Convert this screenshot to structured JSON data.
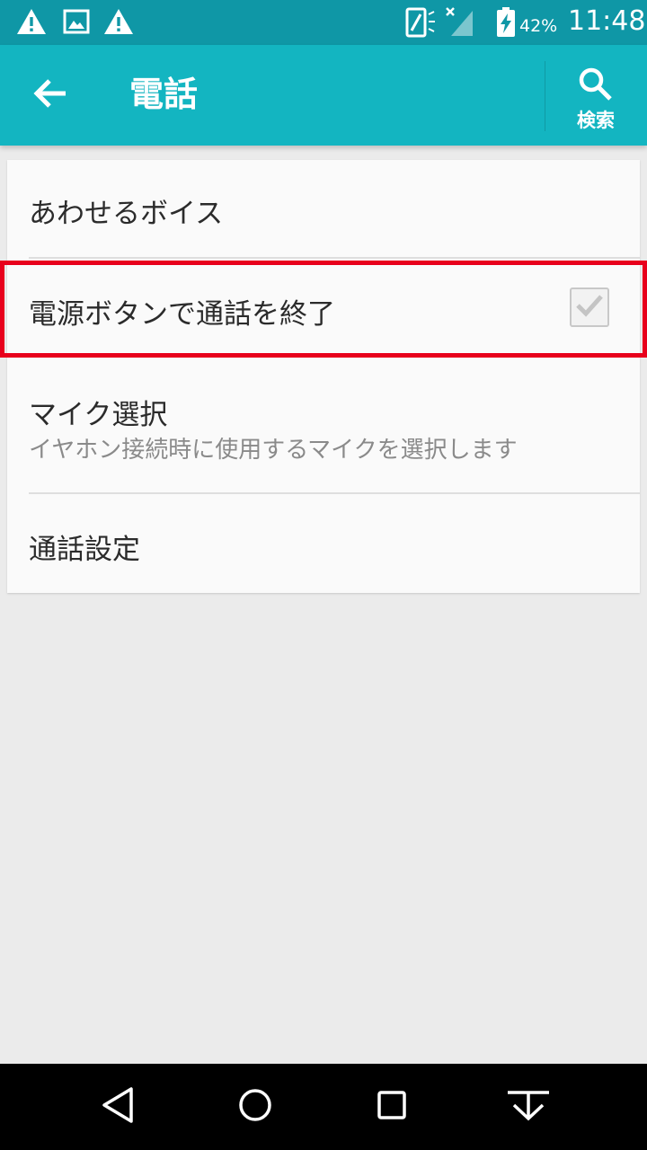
{
  "status_bar": {
    "battery_percent": "42%",
    "time": "11:48"
  },
  "app_bar": {
    "title": "電話",
    "search_label": "検索"
  },
  "settings": [
    {
      "title": "あわせるボイス"
    },
    {
      "title": "電源ボタンで通話を終了",
      "checked": true
    },
    {
      "title": "マイク選択",
      "summary": "イヤホン接続時に使用するマイクを選択します"
    },
    {
      "title": "通話設定"
    }
  ],
  "colors": {
    "status_bar": "#0f97a6",
    "app_bar": "#13b5c1",
    "highlight": "#e8001c",
    "background": "#ebebeb"
  },
  "icons": {
    "status_left": [
      "warning-icon",
      "image-icon",
      "warning-icon"
    ],
    "status_right": [
      "screen-rotation-icon",
      "signal-icon",
      "battery-charging-icon"
    ],
    "app_bar": [
      "back-arrow-icon",
      "search-icon"
    ],
    "nav": [
      "back-triangle-icon",
      "home-circle-icon",
      "recents-square-icon",
      "notification-pull-icon"
    ]
  }
}
